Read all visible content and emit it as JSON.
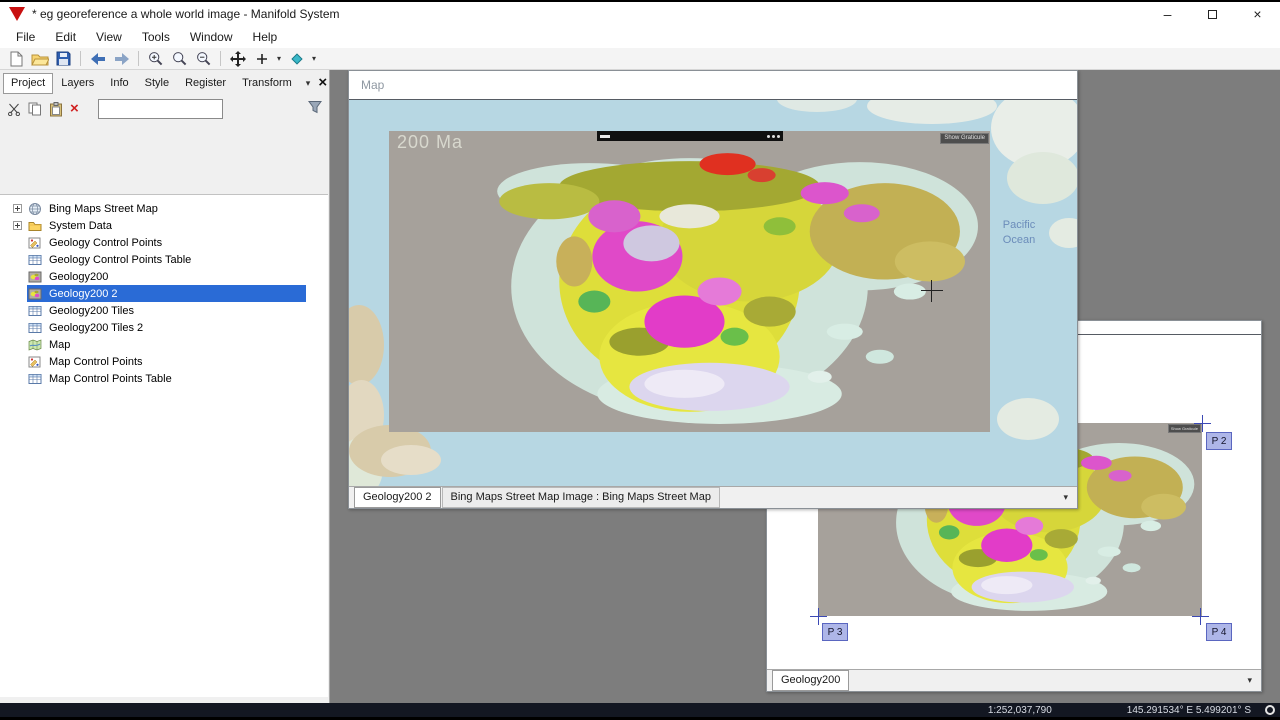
{
  "titlebar": {
    "title": "* eg georeference a whole world image - Manifold System"
  },
  "glyphs": {
    "close": "×",
    "minimize": "–",
    "dropdown": "▾",
    "delete": "×"
  },
  "menu": {
    "items": [
      "File",
      "Edit",
      "View",
      "Tools",
      "Window",
      "Help"
    ]
  },
  "pane": {
    "tabs": [
      "Project",
      "Layers",
      "Info",
      "Style",
      "Register",
      "Transform"
    ],
    "active_tab": "Project",
    "search_value": "",
    "tree": [
      {
        "label": "Bing Maps Street Map",
        "icon": "globe-icon",
        "expandable": true,
        "selected": false
      },
      {
        "label": "System Data",
        "icon": "folder-icon",
        "expandable": true,
        "selected": false
      },
      {
        "label": "Geology Control Points",
        "icon": "control-points-icon",
        "expandable": false,
        "selected": false
      },
      {
        "label": "Geology Control Points Table",
        "icon": "table-icon",
        "expandable": false,
        "selected": false
      },
      {
        "label": "Geology200",
        "icon": "image-icon",
        "expandable": false,
        "selected": false
      },
      {
        "label": "Geology200 2",
        "icon": "image-icon",
        "expandable": false,
        "selected": true
      },
      {
        "label": "Geology200 Tiles",
        "icon": "table-icon",
        "expandable": false,
        "selected": false
      },
      {
        "label": "Geology200 Tiles 2",
        "icon": "table-icon",
        "expandable": false,
        "selected": false
      },
      {
        "label": "Map",
        "icon": "map-icon",
        "expandable": false,
        "selected": false
      },
      {
        "label": "Map Control Points",
        "icon": "control-points-icon",
        "expandable": false,
        "selected": false
      },
      {
        "label": "Map Control Points Table",
        "icon": "table-icon",
        "expandable": false,
        "selected": false
      }
    ]
  },
  "map_window": {
    "title": "Map",
    "image_overlay": {
      "age_label": "200 Ma",
      "graticule_button": "Show Graticule"
    },
    "basemap": {
      "ocean_label": [
        "Pacific",
        "Ocean"
      ]
    },
    "tabs": [
      "Geology200 2",
      "Bing Maps Street Map Image : Bing Maps Street Map"
    ],
    "active_tab": "Geology200 2"
  },
  "image_window": {
    "graticule_button": "Show Graticule",
    "control_points": [
      "P 2",
      "P 3",
      "P 4"
    ],
    "tabs": [
      "Geology200"
    ],
    "active_tab": "Geology200"
  },
  "statusbar": {
    "scale": "1:252,037,790",
    "coordinates": "145.291534° E  5.499201° S"
  }
}
